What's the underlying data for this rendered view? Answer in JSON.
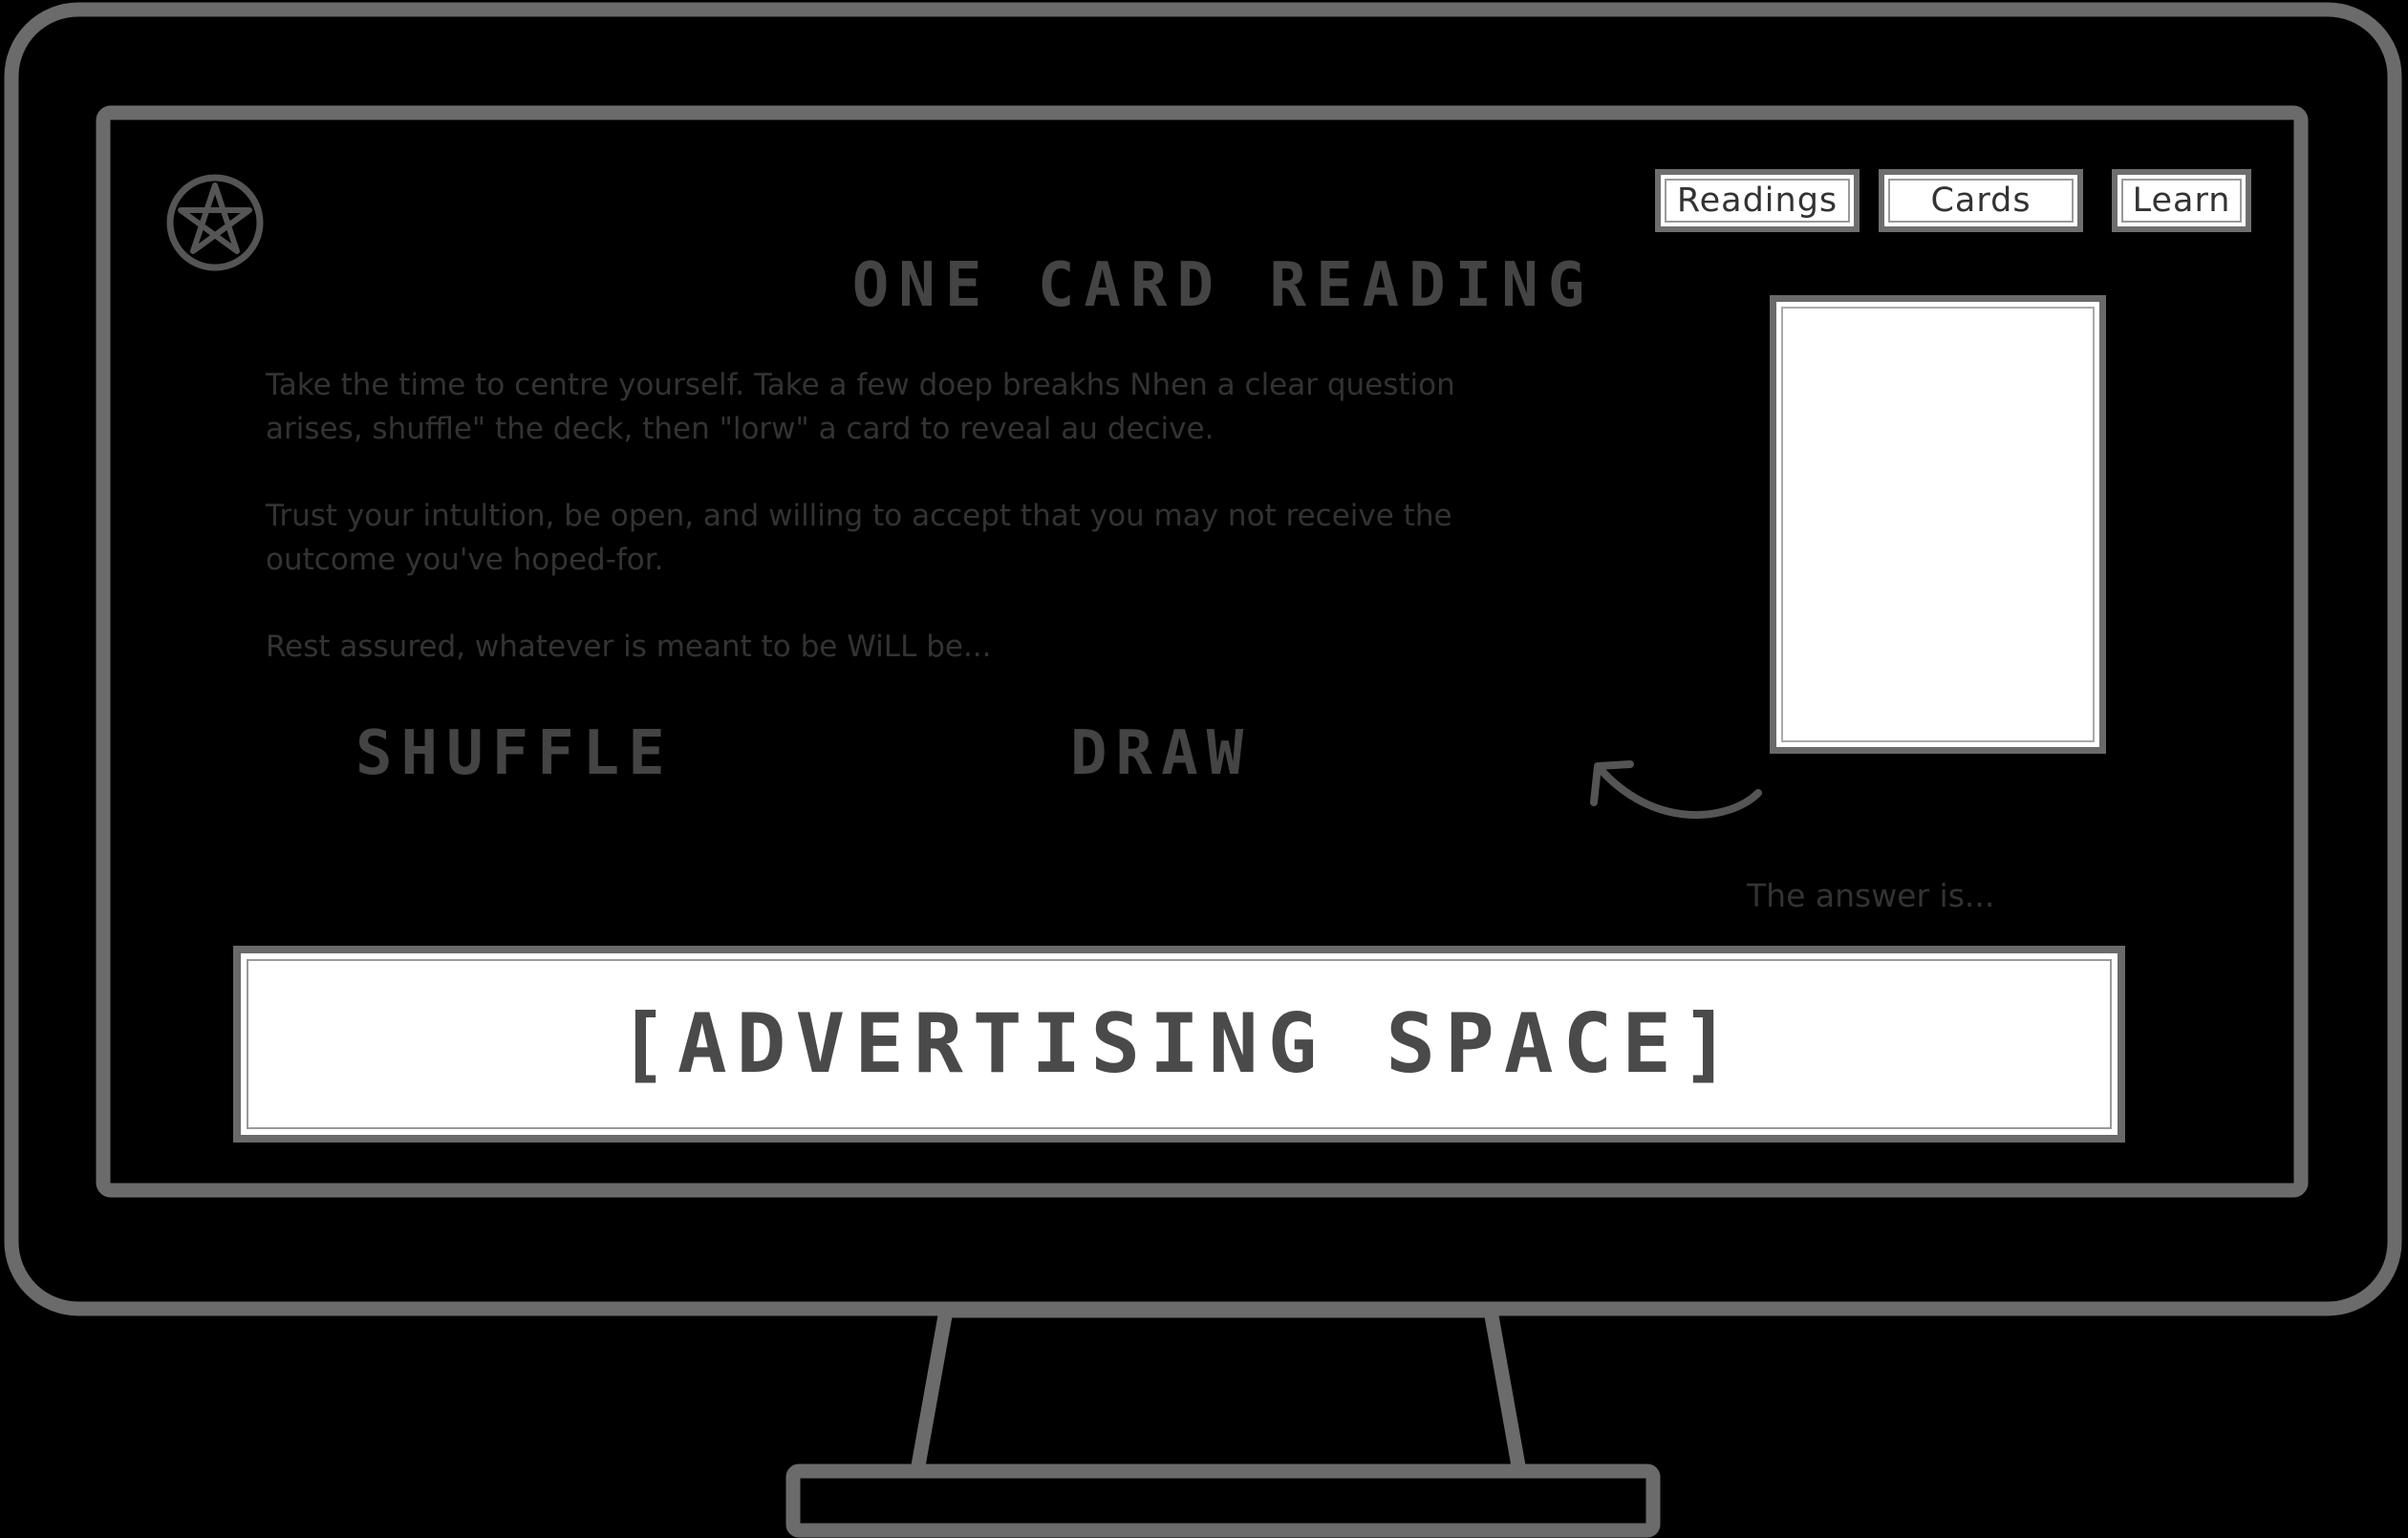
{
  "nav": {
    "items": [
      "Readings",
      "Cards",
      "Learn"
    ]
  },
  "page": {
    "title": "ONE CARD READING",
    "paragraph_1_line_1": "Take the time to centre yourself. Take a few doep breakhs  Nhen a clear question",
    "paragraph_1_line_2": "arises,  shuffle\" the deck, then \"lorw\"  a card  to reveal au decive.",
    "paragraph_2_line_1": "Trust your intultion, be open, and willing to accept that you may not receive the",
    "paragraph_2_line_2": "outcome you've hoped-for.",
    "paragraph_3": "Rest assured, whatever is meant to be WiLL be...",
    "shuffle_label": "SHUFFLE",
    "draw_label": "DRAW",
    "answer_label": "The answer is...",
    "ad_label": "[ADVERTISING SPACE]"
  },
  "icons": {
    "logo": "pentacle-icon",
    "arrow": "curved-arrow-icon"
  },
  "colors": {
    "frame_stroke": "#6b6b6b",
    "screen_bg": "#ffffff",
    "text": "#333333",
    "backdrop": "#000000"
  }
}
